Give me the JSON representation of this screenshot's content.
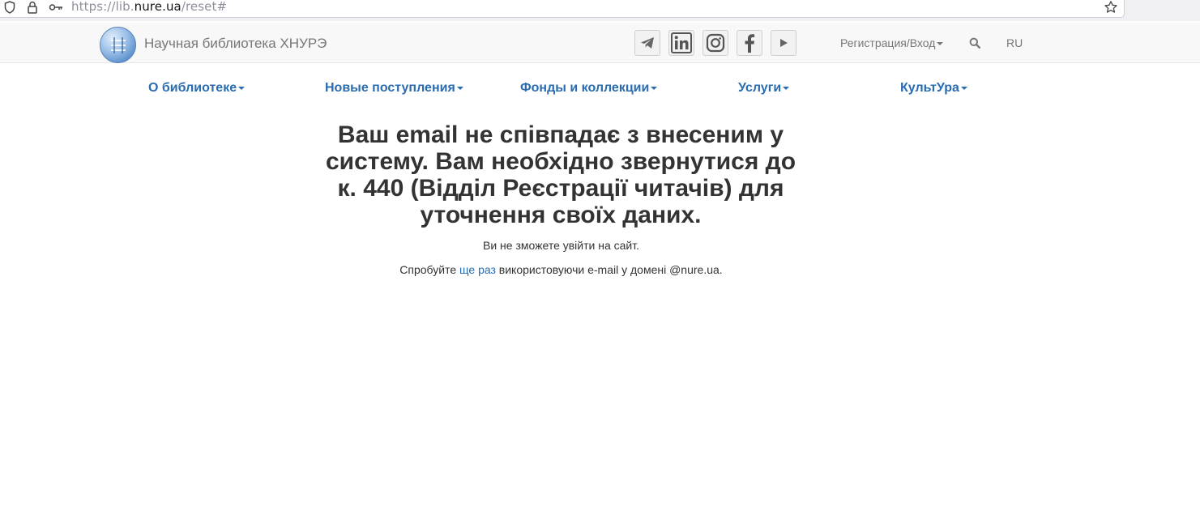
{
  "browser": {
    "url_scheme": "https://lib.",
    "url_host": "nure.ua",
    "url_path": "/reset#"
  },
  "header": {
    "site_title": "Научная библиотека ХНУРЭ",
    "login_label": "Регистрация/Вход",
    "lang_label": "RU",
    "social_icons": [
      "telegram-icon",
      "linkedin-icon",
      "instagram-icon",
      "facebook-icon",
      "youtube-icon"
    ]
  },
  "menu": {
    "items": [
      {
        "label": "О библиотеке"
      },
      {
        "label": "Новые поступления"
      },
      {
        "label": "Фонды и коллекции"
      },
      {
        "label": "Услуги"
      },
      {
        "label": "КультУра"
      }
    ]
  },
  "content": {
    "headline": "Ваш email не співпадає з внесеним у систему. Вам необхідно звернутися до к. 440 (Відділ Реєстрації читачів) для уточнення своїх даних.",
    "notice": "Ви не зможете увійти на сайт.",
    "retry_prefix": "Спробуйте ",
    "retry_link": "ще раз",
    "retry_suffix": " використовуючи e-mail у домені @nure.ua."
  },
  "colors": {
    "menu_link": "#2a6cb0",
    "header_bg": "#f8f8f8"
  }
}
